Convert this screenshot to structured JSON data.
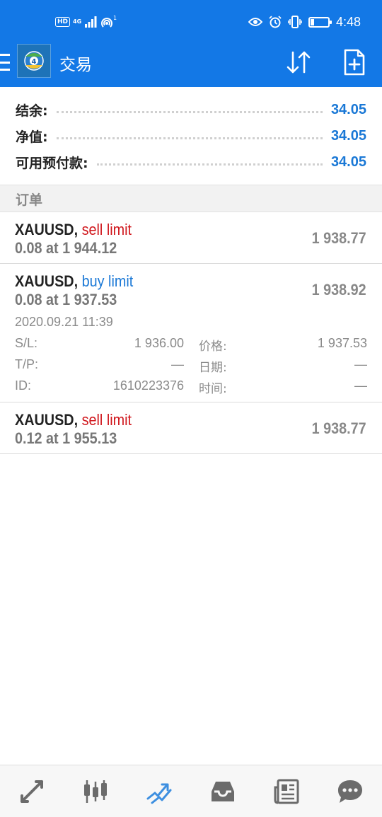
{
  "status_bar": {
    "hd_label": "HD",
    "network_label": "4G",
    "time": "4:48"
  },
  "app_bar": {
    "title": "交易",
    "icons": [
      "menu-icon",
      "metatrader-logo",
      "sort-icon",
      "new-order-icon"
    ]
  },
  "account": {
    "balance_label": "结余:",
    "balance_value": "34.05",
    "equity_label": "净值:",
    "equity_value": "34.05",
    "free_margin_label": "可用预付款:",
    "free_margin_value": "34.05"
  },
  "orders_section": {
    "header": "订单"
  },
  "orders": [
    {
      "symbol": "XAUUSD,",
      "type": "sell limit",
      "volume_line": "0.08 at 1 944.12",
      "current_price": "1 938.77"
    },
    {
      "symbol": "XAUUSD,",
      "type": "buy limit",
      "volume_line": "0.08 at 1 937.53",
      "current_price": "1 938.92",
      "date": "2020.09.21 11:39",
      "sl_label": "S/L:",
      "sl_value": "1 936.00",
      "tp_label": "T/P:",
      "tp_value": "—",
      "id_label": "ID:",
      "id_value": "1610223376",
      "price_label": "价格:",
      "price_value": "1 937.53",
      "expiry_date_label": "日期:",
      "expiry_date_value": "—",
      "expiry_time_label": "时间:",
      "expiry_time_value": "—"
    },
    {
      "symbol": "XAUUSD,",
      "type": "sell limit",
      "volume_line": "0.12 at 1 955.13",
      "current_price": "1 938.77"
    }
  ],
  "bottom_nav": {
    "items": [
      "quotes-icon",
      "chart-icon",
      "trade-icon",
      "history-icon",
      "news-icon",
      "messages-icon"
    ],
    "active": "trade-icon"
  },
  "colors": {
    "header_blue": "#1378e6",
    "value_blue": "#1a78d6",
    "sell_red": "#d0161c",
    "active_nav": "#3d8fe0",
    "inactive_nav": "#6b6b6b"
  },
  "battery_level_pct": 20
}
